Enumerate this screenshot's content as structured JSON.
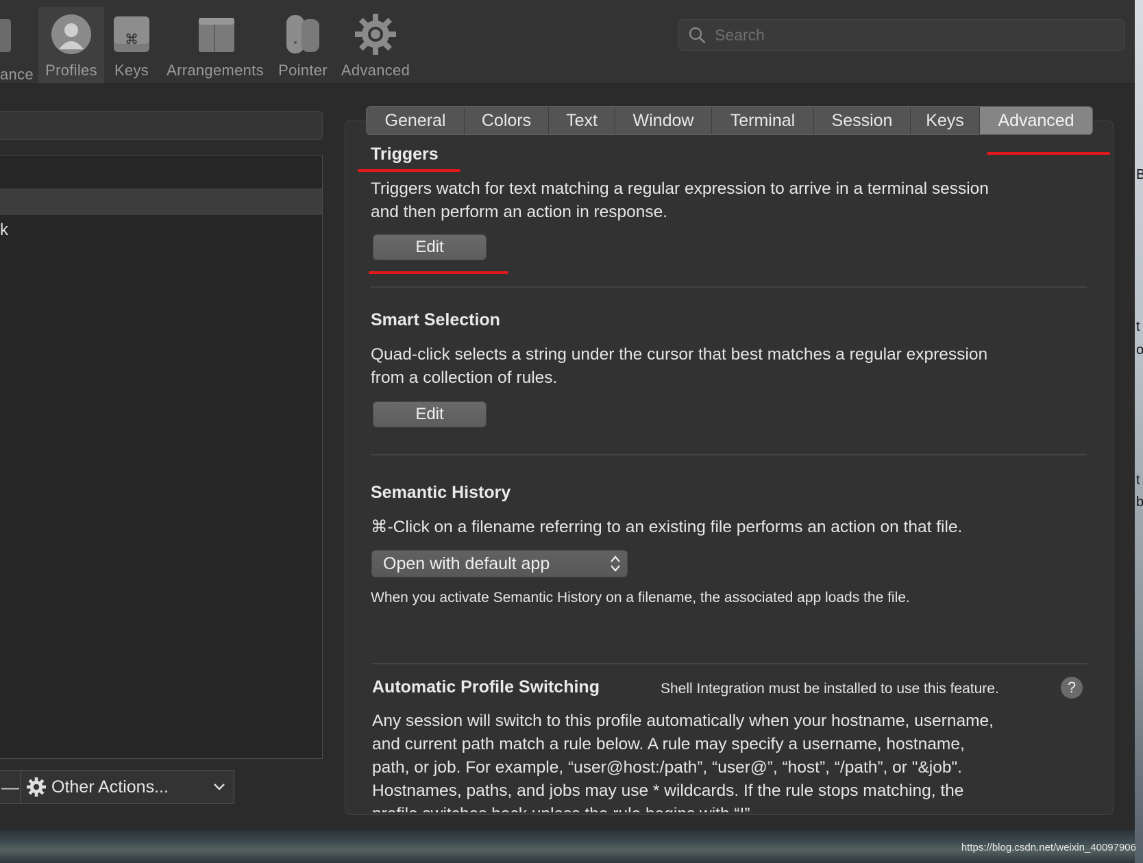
{
  "toolbar": {
    "items": [
      {
        "label": "ance",
        "icon": "appearance-icon"
      },
      {
        "label": "Profiles",
        "icon": "profile-icon"
      },
      {
        "label": "Keys",
        "icon": "keyboard-icon"
      },
      {
        "label": "Arrangements",
        "icon": "arrangements-icon"
      },
      {
        "label": "Pointer",
        "icon": "mouse-icon"
      },
      {
        "label": "Advanced",
        "icon": "gear-icon"
      }
    ],
    "search_placeholder": "Search"
  },
  "left_pane": {
    "visible_row": "k",
    "other_actions_label": "Other Actions...",
    "minus_label": "—"
  },
  "tabs": [
    {
      "label": "General"
    },
    {
      "label": "Colors"
    },
    {
      "label": "Text"
    },
    {
      "label": "Window"
    },
    {
      "label": "Terminal"
    },
    {
      "label": "Session"
    },
    {
      "label": "Keys"
    },
    {
      "label": "Advanced",
      "active": true
    }
  ],
  "triggers": {
    "title": "Triggers",
    "description_line1": "Triggers watch for text matching a regular expression to arrive in a terminal session",
    "description_line2": "and then perform an action in response.",
    "button": "Edit"
  },
  "smart_selection": {
    "title": "Smart Selection",
    "description_line1": "Quad-click selects a string under the cursor that best matches a regular expression",
    "description_line2": "from a collection of rules.",
    "button": "Edit"
  },
  "semantic_history": {
    "title": "Semantic History",
    "description": "⌘-Click on a filename referring to an existing file performs an action on that file.",
    "selected_option": "Open with default app",
    "note": "When you activate Semantic History on a filename, the associated app loads the file."
  },
  "auto_profile_switching": {
    "title": "Automatic Profile Switching",
    "shell_note": "Shell Integration must be installed to use this feature.",
    "help_label": "?",
    "line1": "Any session will switch to this profile automatically when your hostname, username,",
    "line2": "and current path match a rule below. A rule may specify a username, hostname,",
    "line3": "path, or job. For example, “user@host:/path”, “user@”, “host”, “/path”, or \"&job\".",
    "line4": "Hostnames, paths, and jobs may use * wildcards. If the rule stops matching, the",
    "line5": "profile switches back unless the rule begins with “!”."
  },
  "right_edge": {
    "b1": "B",
    "t1": "t",
    "o1": "o",
    "t2": "t",
    "b2": "b"
  },
  "watermark": "https://blog.csdn.net/weixin_40097906",
  "colors": {
    "annotation_red": "#e0191c",
    "window_bg": "#2b2b2b",
    "panel_bg": "#323232"
  }
}
